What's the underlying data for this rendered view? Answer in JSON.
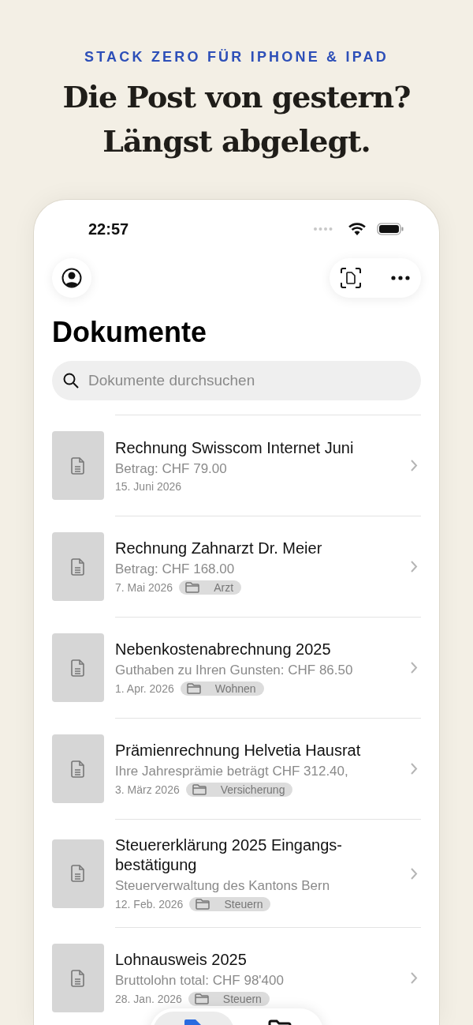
{
  "promo": {
    "tagline": "STACK ZERO FÜR IPHONE & IPAD",
    "headline": [
      "Die Post von gestern?",
      "Längst abgelegt."
    ]
  },
  "status_bar": {
    "time": "22:57"
  },
  "screen": {
    "title": "Dokumente"
  },
  "search": {
    "placeholder": "Dokumente durchsuchen"
  },
  "documents": [
    {
      "title": "Rechnung Swisscom Internet Juni",
      "summary": "Betrag: CHF 79.00",
      "date": "15. Juni 2026"
    },
    {
      "title": "Rechnung Zahnarzt Dr. Meier",
      "summary": "Betrag: CHF 168.00",
      "date": "7. Mai 2026",
      "folder": "Arzt"
    },
    {
      "title": "Nebenkostenabrechnung 2025",
      "summary": "Guthaben zu Ihren Gunsten: CHF 86.50",
      "date": "1. Apr. 2026",
      "folder": "Wohnen"
    },
    {
      "title": "Prämienrechnung Helvetia Hausrat",
      "summary": "Ihre Jahresprämie beträgt CHF 312.40,",
      "date": "3. März 2026",
      "folder": "Versicherung"
    },
    {
      "title": "Steuererklärung 2025 Eingangs-bestätigung",
      "summary": "Steuerverwaltung des Kantons Bern",
      "date": "12. Feb. 2026",
      "folder": "Steuern"
    },
    {
      "title": "Lohnausweis 2025",
      "summary": "Bruttolohn total: CHF 98'400",
      "date": "28. Jan. 2026",
      "folder": "Steuern"
    }
  ],
  "tab_bar": [
    {
      "kind": "documents",
      "selected": true
    },
    {
      "kind": "folders",
      "selected": false
    }
  ]
}
